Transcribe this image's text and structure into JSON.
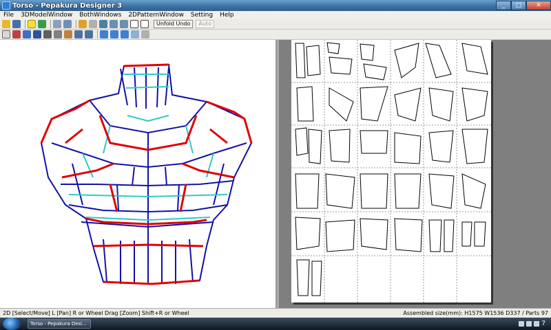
{
  "window": {
    "title": "Torso - Pepakura Designer 3",
    "min": "_",
    "max": "□",
    "close": "✕"
  },
  "menu": [
    "File",
    "3DModelWindow",
    "BothWindows",
    "2DPatternWindow",
    "Setting",
    "Help"
  ],
  "toolbar": {
    "unfold_undo": "Unfold Undo",
    "auto": "Auto"
  },
  "status": {
    "left": "2D [Select/Move] L [Pan] R or Wheel Drag [Zoom] Shift+R or Wheel",
    "right": "Assembled size(mm): H1575 W1536 D337 / Parts 97"
  },
  "taskbar": {
    "task": "Torso - Pepakura Desi...",
    "clock": "7"
  },
  "colors": {
    "mountain": "#e00000",
    "valley": "#1010aa",
    "cyan": "#30c8c8"
  }
}
